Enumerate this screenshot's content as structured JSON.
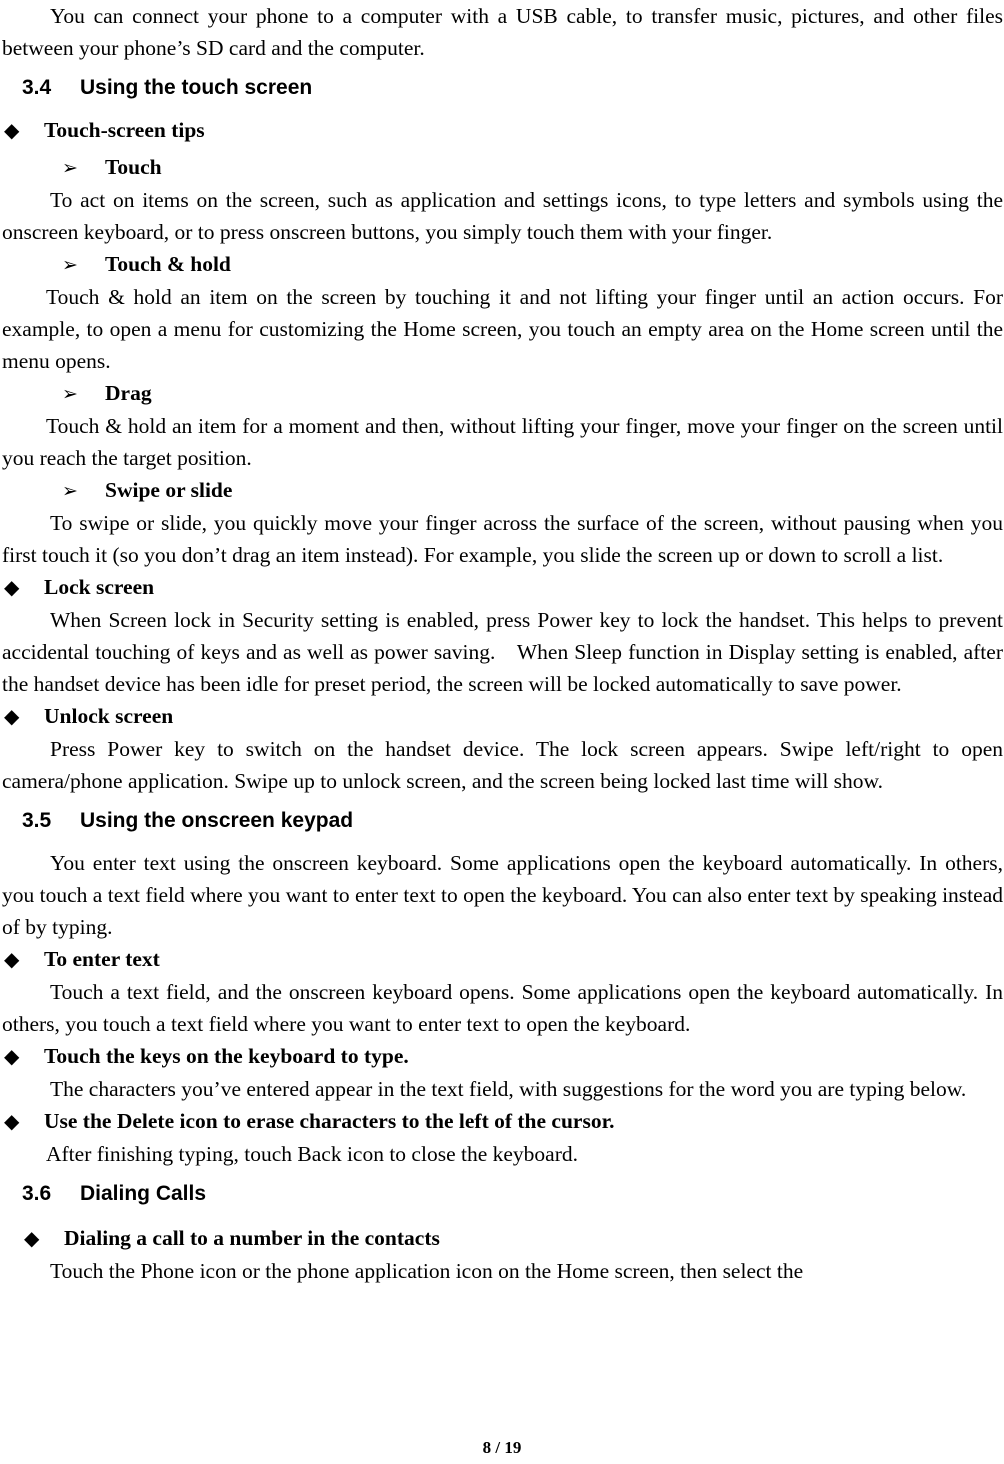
{
  "document": {
    "page_footer": "8 / 19",
    "bullets": {
      "diamond": "◆",
      "arrow": "➢"
    },
    "blocks": [
      {
        "type": "paragraph",
        "text": "You can connect your phone to a computer with a USB cable, to transfer music, pictures, and other files between your phone’s SD card and the computer."
      },
      {
        "type": "section-heading",
        "number": "3.4",
        "title": "Using the touch screen"
      },
      {
        "type": "diamond-heading",
        "text": "Touch-screen tips"
      },
      {
        "type": "arrow-heading",
        "text": "Touch"
      },
      {
        "type": "paragraph",
        "text": "To act on items on the screen, such as application and settings icons, to type letters and symbols using the onscreen keyboard, or to press onscreen buttons, you simply touch them with your finger."
      },
      {
        "type": "arrow-heading",
        "text": "Touch & hold"
      },
      {
        "type": "paragraph",
        "text": "Touch & hold an item on the screen by touching it and not lifting your finger until an action occurs. For example, to open a menu for customizing the Home screen, you touch an empty area on the Home screen until the menu opens."
      },
      {
        "type": "arrow-heading",
        "text": "Drag"
      },
      {
        "type": "paragraph",
        "text": "Touch & hold an item for a moment and then, without lifting your finger, move your finger on the screen until you reach the target position."
      },
      {
        "type": "arrow-heading",
        "text": "Swipe or slide"
      },
      {
        "type": "paragraph",
        "text": "To swipe or slide, you quickly move your finger across the surface of the screen, without pausing when you first touch it (so you don’t drag an item instead). For example, you slide the screen up or down to scroll a list."
      },
      {
        "type": "diamond-heading",
        "text": "Lock screen"
      },
      {
        "type": "paragraph",
        "text": "When Screen lock in Security setting is enabled, press Power key to lock the handset. This helps to prevent accidental touching of keys and as well as power saving. When Sleep function in Display setting is enabled, after the handset device has been idle for preset period, the screen will be locked automatically to save power."
      },
      {
        "type": "diamond-heading",
        "text": "Unlock screen"
      },
      {
        "type": "paragraph",
        "text": "Press Power key to switch on the handset device. The lock screen appears. Swipe left/right to open camera/phone application. Swipe up to unlock screen, and the screen being locked last time will show."
      },
      {
        "type": "section-heading",
        "number": "3.5",
        "title": "Using the onscreen keypad"
      },
      {
        "type": "paragraph",
        "text": "You enter text using the onscreen keyboard. Some applications open the keyboard automatically. In others, you touch a text field where you want to enter text to open the keyboard. You can also enter text by speaking instead of by typing."
      },
      {
        "type": "diamond-heading",
        "text": "To enter text"
      },
      {
        "type": "paragraph",
        "text": "Touch a text field, and the onscreen keyboard opens. Some applications open the keyboard automatically. In others, you touch a text field where you want to enter text to open the keyboard."
      },
      {
        "type": "diamond-heading",
        "text": "Touch the keys on the keyboard to type."
      },
      {
        "type": "paragraph",
        "text": "The characters you’ve entered appear in the text field, with suggestions for the word you are typing below."
      },
      {
        "type": "diamond-heading",
        "text": "Use the Delete icon to erase characters to the left of the cursor."
      },
      {
        "type": "paragraph",
        "text": "After finishing typing, touch Back icon to close the keyboard."
      },
      {
        "type": "section-heading",
        "number": "3.6",
        "title": "Dialing Calls"
      },
      {
        "type": "diamond-heading",
        "text": "Dialing a call to a number in the contacts"
      },
      {
        "type": "paragraph",
        "text": "Touch the Phone icon or the phone application icon on the Home screen, then select the"
      }
    ]
  }
}
